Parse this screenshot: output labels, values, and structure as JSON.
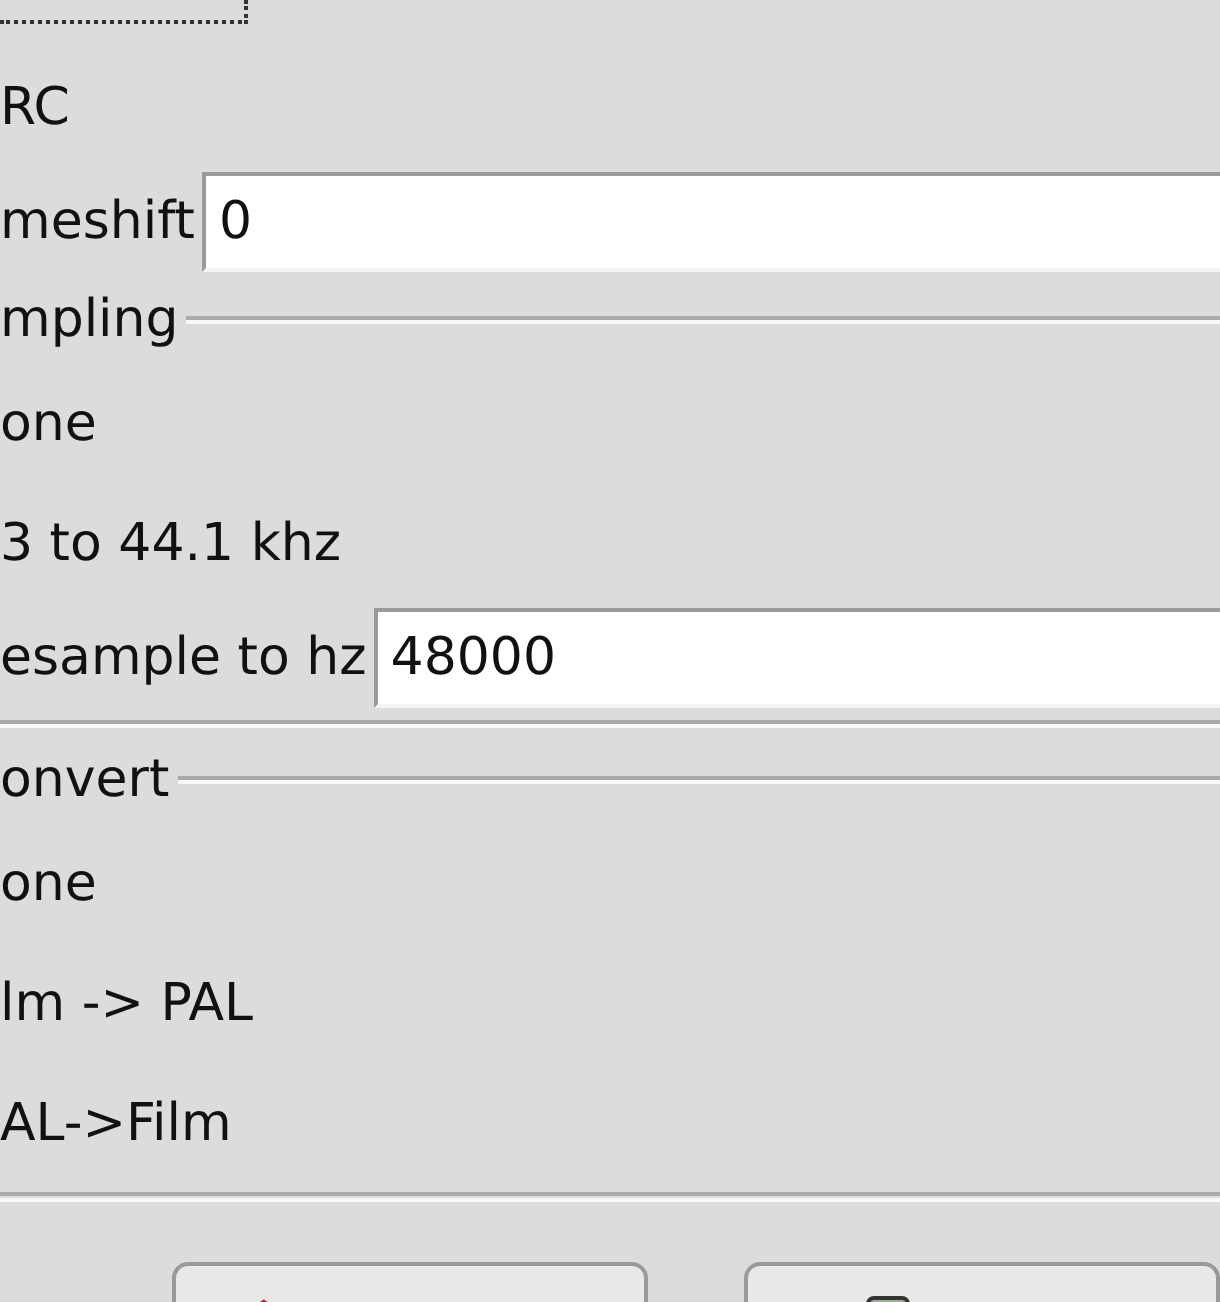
{
  "top_options": [
    {
      "label": "RC"
    }
  ],
  "timeshift": {
    "label": "meshift",
    "value": "0"
  },
  "resampling": {
    "title": "mpling",
    "options": [
      {
        "kind": "option",
        "label": "one"
      },
      {
        "kind": "option",
        "label": "3 to 44.1 khz"
      },
      {
        "kind": "field",
        "label": "esample to hz",
        "value": "48000"
      }
    ]
  },
  "convert": {
    "title": "onvert",
    "options": [
      {
        "kind": "option",
        "label": "one"
      },
      {
        "kind": "option",
        "label": "lm -> PAL"
      },
      {
        "kind": "option",
        "label": "AL->Film"
      }
    ]
  }
}
